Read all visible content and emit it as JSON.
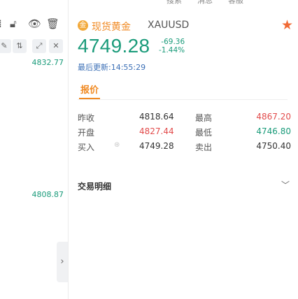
{
  "top_nav": {
    "items": [
      "搜索",
      "消息",
      "客服"
    ]
  },
  "left_panel": {
    "values": [
      "4832.77",
      "4808.87"
    ],
    "collapse_glyph": "›"
  },
  "instrument": {
    "name": "现货黄金",
    "code": "XAUUSD",
    "price": "4749.28",
    "change": "-69.36",
    "change_pct": "-1.44%",
    "updated_label": "最后更新:",
    "updated_time": "14:55:29"
  },
  "tabs": {
    "quote": "报价"
  },
  "quote_table": {
    "rows": [
      {
        "label1": "昨收",
        "value1": "4818.64",
        "label2": "最高",
        "value2": "4867.20"
      },
      {
        "label1": "开盘",
        "value1": "4827.44",
        "label2": "最低",
        "value2": "4746.80"
      },
      {
        "label1": "买入",
        "value1": "4749.28",
        "label2": "卖出",
        "value2": "4750.40"
      }
    ]
  },
  "detail": {
    "label": "交易明细"
  },
  "colors": {
    "accent": "#f08a24",
    "up": "#e24b4b",
    "down": "#1a9b7a",
    "star": "#f06a35"
  }
}
